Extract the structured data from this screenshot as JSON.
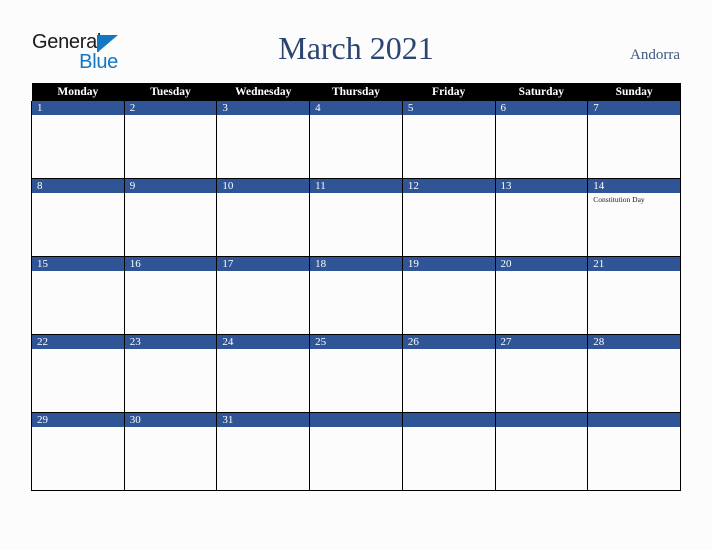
{
  "brand": {
    "name_part1": "General",
    "name_part2": "Blue",
    "triangle_color": "#1477c4"
  },
  "header": {
    "title": "March 2021",
    "region": "Andorra",
    "title_color": "#2b4570",
    "region_color": "#3d5781"
  },
  "calendar": {
    "month": "March",
    "year": "2021",
    "weekday_headers": [
      "Monday",
      "Tuesday",
      "Wednesday",
      "Thursday",
      "Friday",
      "Saturday",
      "Sunday"
    ],
    "header_bg": "#000000",
    "header_text": "#ffffff",
    "daynum_bg": "#2f5597",
    "daynum_text": "#ffffff",
    "cell_bg": "#fcfcfc",
    "border_color": "#000000",
    "weeks": [
      {
        "days": [
          {
            "num": "1",
            "events": []
          },
          {
            "num": "2",
            "events": []
          },
          {
            "num": "3",
            "events": []
          },
          {
            "num": "4",
            "events": []
          },
          {
            "num": "5",
            "events": []
          },
          {
            "num": "6",
            "events": []
          },
          {
            "num": "7",
            "events": []
          }
        ]
      },
      {
        "days": [
          {
            "num": "8",
            "events": []
          },
          {
            "num": "9",
            "events": []
          },
          {
            "num": "10",
            "events": []
          },
          {
            "num": "11",
            "events": []
          },
          {
            "num": "12",
            "events": []
          },
          {
            "num": "13",
            "events": []
          },
          {
            "num": "14",
            "events": [
              "Constitution Day"
            ]
          }
        ]
      },
      {
        "days": [
          {
            "num": "15",
            "events": []
          },
          {
            "num": "16",
            "events": []
          },
          {
            "num": "17",
            "events": []
          },
          {
            "num": "18",
            "events": []
          },
          {
            "num": "19",
            "events": []
          },
          {
            "num": "20",
            "events": []
          },
          {
            "num": "21",
            "events": []
          }
        ]
      },
      {
        "days": [
          {
            "num": "22",
            "events": []
          },
          {
            "num": "23",
            "events": []
          },
          {
            "num": "24",
            "events": []
          },
          {
            "num": "25",
            "events": []
          },
          {
            "num": "26",
            "events": []
          },
          {
            "num": "27",
            "events": []
          },
          {
            "num": "28",
            "events": []
          }
        ]
      },
      {
        "days": [
          {
            "num": "29",
            "events": []
          },
          {
            "num": "30",
            "events": []
          },
          {
            "num": "31",
            "events": []
          },
          {
            "num": "",
            "events": []
          },
          {
            "num": "",
            "events": []
          },
          {
            "num": "",
            "events": []
          },
          {
            "num": "",
            "events": []
          }
        ]
      }
    ]
  }
}
